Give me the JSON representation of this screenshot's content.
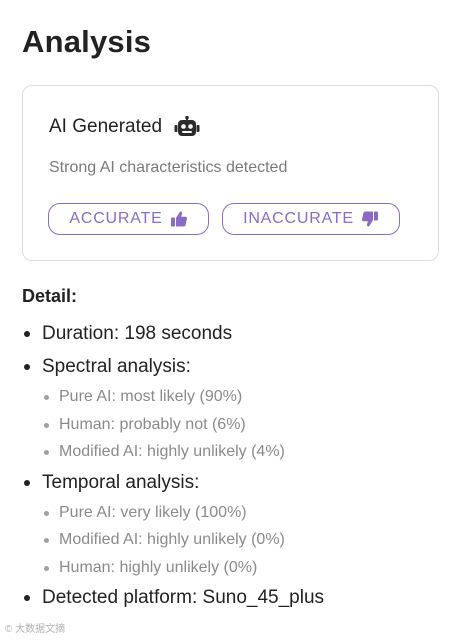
{
  "page": {
    "title": "Analysis"
  },
  "result": {
    "label": "AI Generated",
    "icon": "robot-icon",
    "description": "Strong AI characteristics detected",
    "accent_color": "#8a6cc4"
  },
  "feedback": {
    "accurate_label": "ACCURATE",
    "accurate_icon": "thumbs-up-icon",
    "inaccurate_label": "INACCURATE",
    "inaccurate_icon": "thumbs-down-icon"
  },
  "detail": {
    "heading": "Detail:",
    "duration": "Duration: 198 seconds",
    "spectral": {
      "label": "Spectral analysis:",
      "items": [
        "Pure AI: most likely (90%)",
        "Human: probably not (6%)",
        "Modified AI: highly unlikely (4%)"
      ]
    },
    "temporal": {
      "label": "Temporal analysis:",
      "items": [
        "Pure AI: very likely (100%)",
        "Modified AI: highly unlikely (0%)",
        "Human: highly unlikely (0%)"
      ]
    },
    "platform": "Detected platform: Suno_45_plus"
  },
  "watermark": "© 大数据文摘"
}
